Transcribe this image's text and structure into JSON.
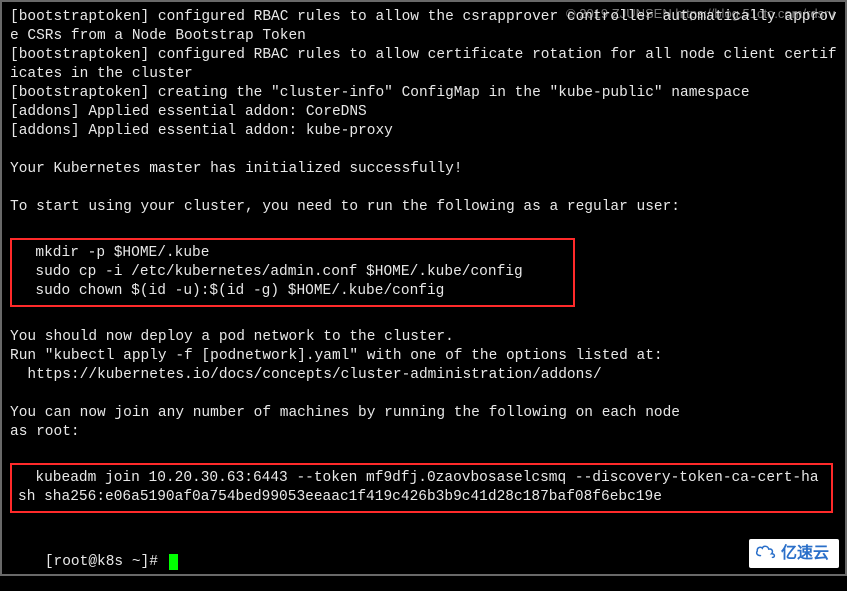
{
  "watermark": "© 2019 ZJUNSEN https://blog.51cto.com/rdsrv",
  "lines": {
    "l1": "[bootstraptoken] configured RBAC rules to allow the csrapprover controller automatically approve CSRs from a Node Bootstrap Token",
    "l2": "[bootstraptoken] configured RBAC rules to allow certificate rotation for all node client certificates in the cluster",
    "l3": "[bootstraptoken] creating the \"cluster-info\" ConfigMap in the \"kube-public\" namespace",
    "l4": "[addons] Applied essential addon: CoreDNS",
    "l5": "[addons] Applied essential addon: kube-proxy",
    "blank1": "",
    "l6": "Your Kubernetes master has initialized successfully!",
    "blank2": "",
    "l7": "To start using your cluster, you need to run the following as a regular user:",
    "blank3": "",
    "b1_1": "  mkdir -p $HOME/.kube",
    "b1_2": "  sudo cp -i /etc/kubernetes/admin.conf $HOME/.kube/config",
    "b1_3": "  sudo chown $(id -u):$(id -g) $HOME/.kube/config",
    "blank4": "",
    "l8": "You should now deploy a pod network to the cluster.",
    "l9": "Run \"kubectl apply -f [podnetwork].yaml\" with one of the options listed at:",
    "l10": "  https://kubernetes.io/docs/concepts/cluster-administration/addons/",
    "blank5": "",
    "l11": "You can now join any number of machines by running the following on each node",
    "l12": "as root:",
    "blank6": "",
    "b2_1": "  kubeadm join 10.20.30.63:6443 --token mf9dfj.0zaovbosaselcsmq --discovery-token-ca-cert-hash sha256:e06a5190af0a754bed99053eeaac1f419c426b3b9c41d28c187baf08f6ebc19e",
    "blank7": "",
    "prompt": "[root@k8s ~]# "
  },
  "logo_text": "亿速云"
}
